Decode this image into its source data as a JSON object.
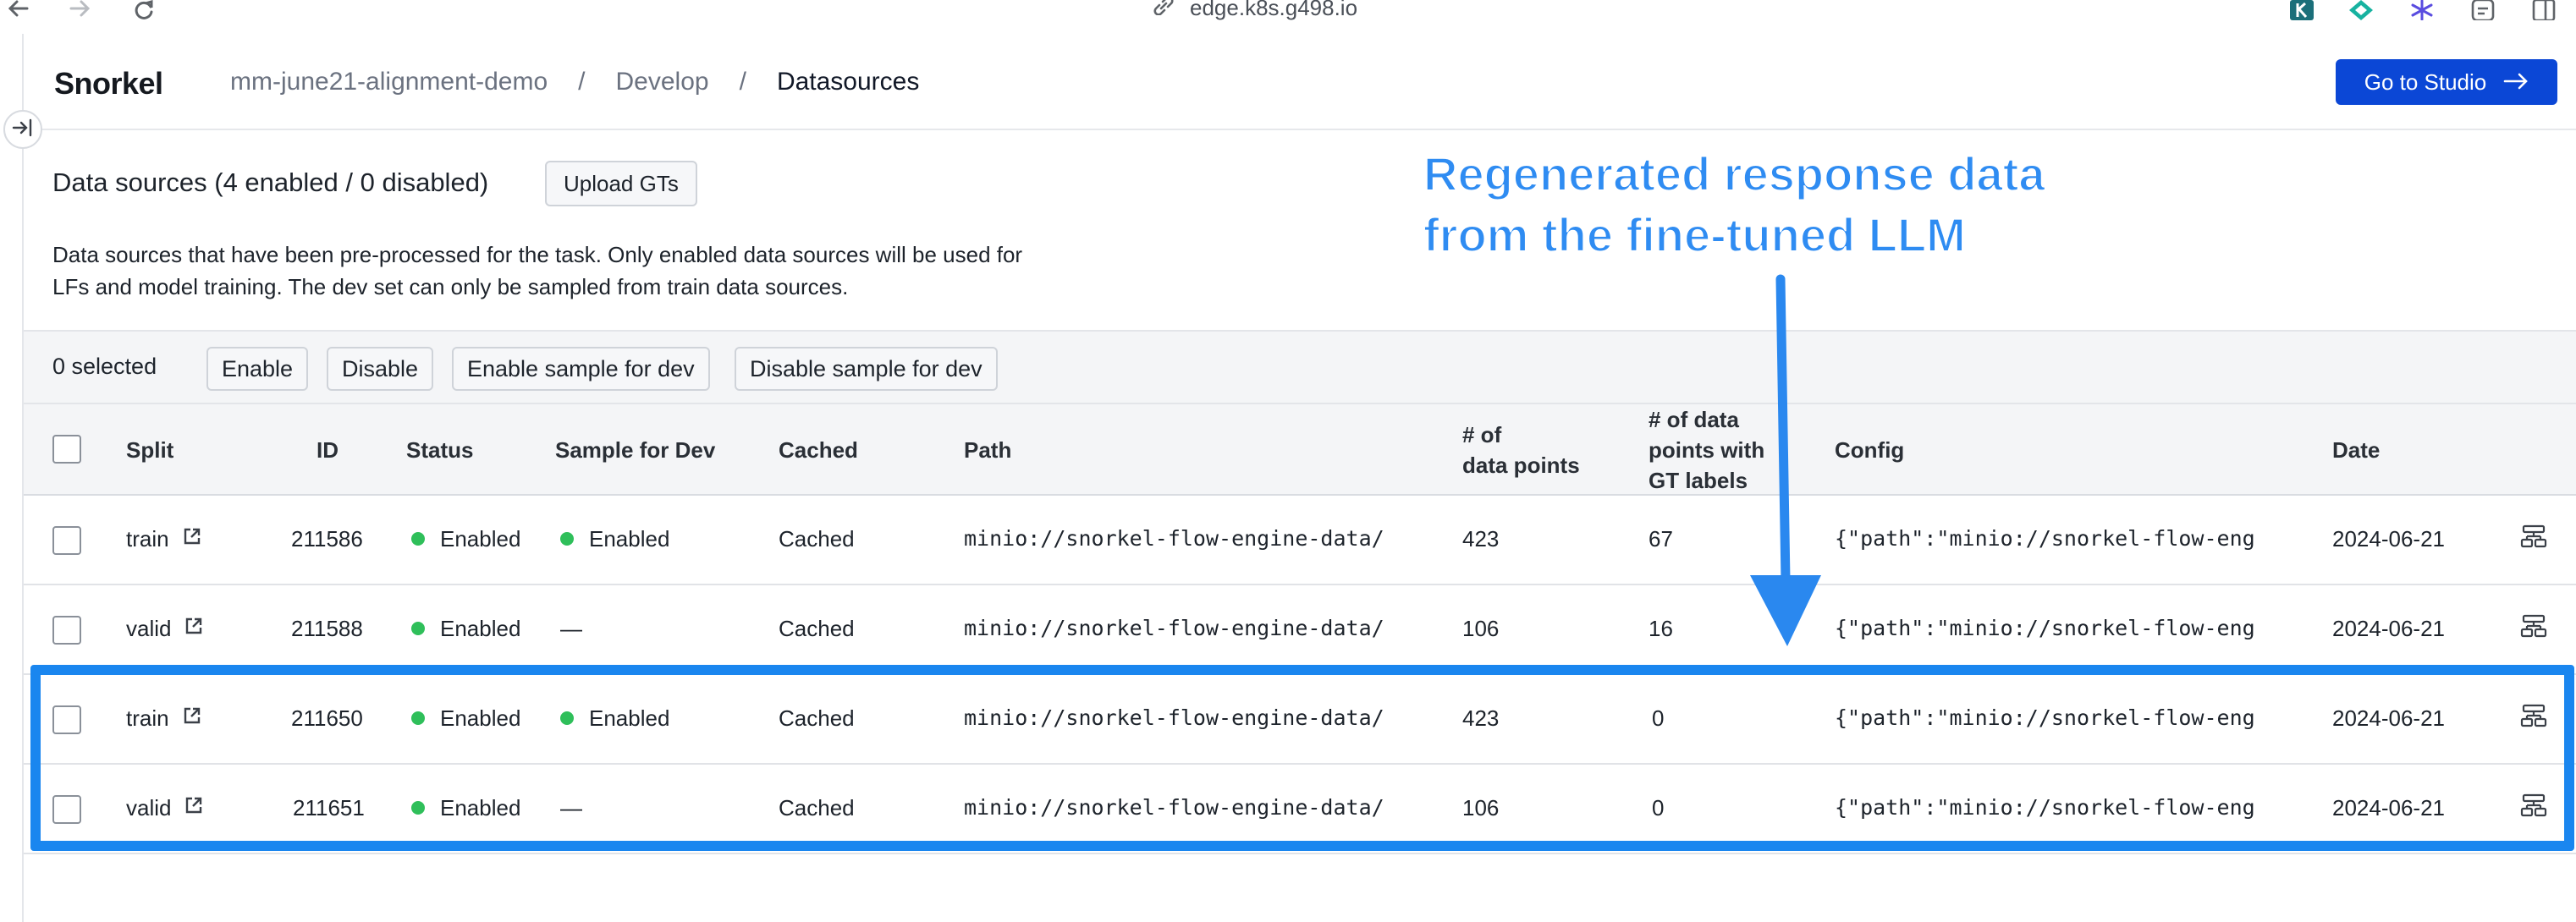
{
  "browser": {
    "url": "edge.k8s.g498.io"
  },
  "app": {
    "logo": "Snorkel",
    "breadcrumb": [
      "mm-june21-alignment-demo",
      "Develop",
      "Datasources"
    ],
    "breadcrumb_separator": "/",
    "studio_button": "Go to Studio",
    "accent": "#0b47d6"
  },
  "section": {
    "title": "Data sources (4 enabled / 0 disabled)",
    "upload_button": "Upload GTs",
    "description_line1": "Data sources that have been pre-processed for the task. Only enabled data sources will be used for",
    "description_line2": "LFs and model training. The dev set can only be sampled from train data sources."
  },
  "actions": {
    "selected": "0 selected",
    "enable": "Enable",
    "disable": "Disable",
    "enable_sample": "Enable sample for dev",
    "disable_sample": "Disable sample for dev"
  },
  "table": {
    "headers": {
      "split": "Split",
      "id": "ID",
      "status": "Status",
      "sample": "Sample for Dev",
      "cached": "Cached",
      "path": "Path",
      "points_l1": "# of",
      "points_l2": "data points",
      "gt_l1": "# of data",
      "gt_l2": "points with",
      "gt_l3": "GT labels",
      "config": "Config",
      "date": "Date"
    },
    "rows": [
      {
        "split": "train",
        "id": "211586",
        "status": "Enabled",
        "sample": "Enabled",
        "cached": "Cached",
        "path": "minio://snorkel-flow-engine-data/",
        "points": "423",
        "gt": "67",
        "config": "{\"path\":\"minio://snorkel-flow-eng",
        "date": "2024-06-21"
      },
      {
        "split": "valid",
        "id": "211588",
        "status": "Enabled",
        "sample": "—",
        "cached": "Cached",
        "path": "minio://snorkel-flow-engine-data/",
        "points": "106",
        "gt": "16",
        "config": "{\"path\":\"minio://snorkel-flow-eng",
        "date": "2024-06-21"
      },
      {
        "split": "train",
        "id": "211650",
        "status": "Enabled",
        "sample": "Enabled",
        "cached": "Cached",
        "path": "minio://snorkel-flow-engine-data/",
        "points": "423",
        "gt": "0",
        "config": "{\"path\":\"minio://snorkel-flow-eng",
        "date": "2024-06-21"
      },
      {
        "split": "valid",
        "id": "211651",
        "status": "Enabled",
        "sample": "—",
        "cached": "Cached",
        "path": "minio://snorkel-flow-engine-data/",
        "points": "106",
        "gt": "0",
        "config": "{\"path\":\"minio://snorkel-flow-eng",
        "date": "2024-06-21"
      }
    ],
    "status_color": "#2fbf5a"
  },
  "annotation": {
    "line1": "Regenerated response data",
    "line2": "from the fine-tuned LLM",
    "color": "#1a86ef"
  }
}
